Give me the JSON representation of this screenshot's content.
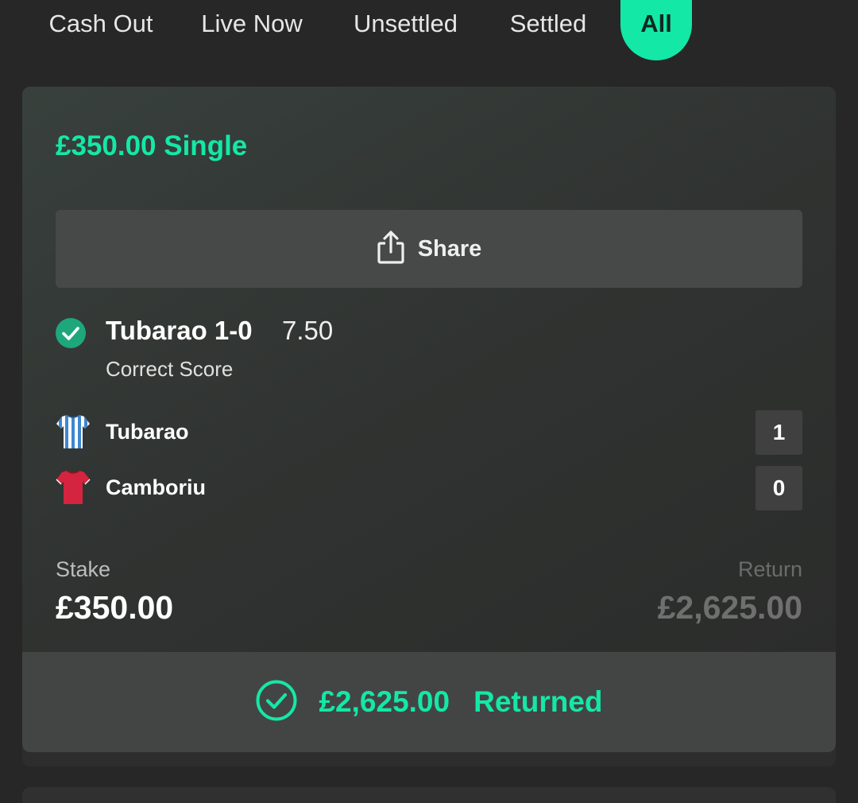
{
  "tabs": [
    {
      "label": "Cash Out",
      "active": false
    },
    {
      "label": "Live Now",
      "active": false
    },
    {
      "label": "Unsettled",
      "active": false
    },
    {
      "label": "Settled",
      "active": false
    },
    {
      "label": "All",
      "active": true
    }
  ],
  "bet": {
    "title": "£350.00 Single",
    "share_label": "Share",
    "selection": {
      "name": "Tubarao 1-0",
      "odds": "7.50",
      "market": "Correct Score",
      "status_icon": "check-circle-icon"
    },
    "teams": [
      {
        "name": "Tubarao",
        "score": "1",
        "kit": "blue-white-striped-shirt-icon"
      },
      {
        "name": "Camboriu",
        "score": "0",
        "kit": "red-shirt-icon"
      }
    ],
    "stake_label": "Stake",
    "stake_value": "£350.00",
    "return_label": "Return",
    "return_value": "£2,625.00",
    "result_amount": "£2,625.00",
    "result_status": "Returned"
  },
  "colors": {
    "accent": "#14e8a6",
    "background": "#272727",
    "card": "#333634"
  }
}
